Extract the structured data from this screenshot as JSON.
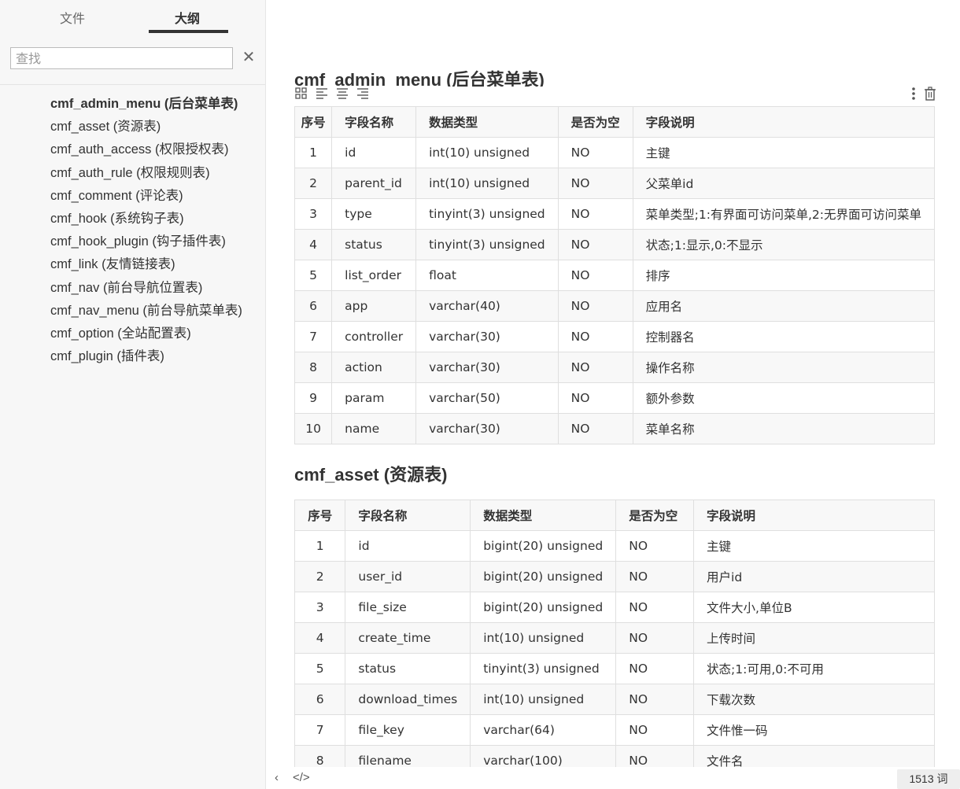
{
  "sidebar": {
    "tabs": [
      {
        "label": "文件"
      },
      {
        "label": "大纲"
      }
    ],
    "search": {
      "placeholder": "查找",
      "clear_icon": "✕"
    },
    "outline": [
      {
        "label": "cmf_admin_menu (后台菜单表)"
      },
      {
        "label": "cmf_asset (资源表)"
      },
      {
        "label": "cmf_auth_access (权限授权表)"
      },
      {
        "label": "cmf_auth_rule (权限规则表)"
      },
      {
        "label": "cmf_comment (评论表)"
      },
      {
        "label": "cmf_hook (系统钩子表)"
      },
      {
        "label": "cmf_hook_plugin (钩子插件表)"
      },
      {
        "label": "cmf_link (友情链接表)"
      },
      {
        "label": "cmf_nav (前台导航位置表)"
      },
      {
        "label": "cmf_nav_menu (前台导航菜单表)"
      },
      {
        "label": "cmf_option (全站配置表)"
      },
      {
        "label": "cmf_plugin (插件表)"
      }
    ]
  },
  "main": {
    "headers": [
      "序号",
      "字段名称",
      "数据类型",
      "是否为空",
      "字段说明"
    ],
    "table1": {
      "title": "cmf_admin_menu (后台菜单表)",
      "rows": [
        [
          "1",
          "id",
          "int(10) unsigned",
          "NO",
          "主键"
        ],
        [
          "2",
          "parent_id",
          "int(10) unsigned",
          "NO",
          "父菜单id"
        ],
        [
          "3",
          "type",
          "tinyint(3) unsigned",
          "NO",
          "菜单类型;1:有界面可访问菜单,2:无界面可访问菜单"
        ],
        [
          "4",
          "status",
          "tinyint(3) unsigned",
          "NO",
          "状态;1:显示,0:不显示"
        ],
        [
          "5",
          "list_order",
          "float",
          "NO",
          "排序"
        ],
        [
          "6",
          "app",
          "varchar(40)",
          "NO",
          "应用名"
        ],
        [
          "7",
          "controller",
          "varchar(30)",
          "NO",
          "控制器名"
        ],
        [
          "8",
          "action",
          "varchar(30)",
          "NO",
          "操作名称"
        ],
        [
          "9",
          "param",
          "varchar(50)",
          "NO",
          "额外参数"
        ],
        [
          "10",
          "name",
          "varchar(30)",
          "NO",
          "菜单名称"
        ]
      ]
    },
    "table2": {
      "title": "cmf_asset (资源表)",
      "rows": [
        [
          "1",
          "id",
          "bigint(20) unsigned",
          "NO",
          "主键"
        ],
        [
          "2",
          "user_id",
          "bigint(20) unsigned",
          "NO",
          "用户id"
        ],
        [
          "3",
          "file_size",
          "bigint(20) unsigned",
          "NO",
          "文件大小,单位B"
        ],
        [
          "4",
          "create_time",
          "int(10) unsigned",
          "NO",
          "上传时间"
        ],
        [
          "5",
          "status",
          "tinyint(3) unsigned",
          "NO",
          "状态;1:可用,0:不可用"
        ],
        [
          "6",
          "download_times",
          "int(10) unsigned",
          "NO",
          "下载次数"
        ],
        [
          "7",
          "file_key",
          "varchar(64)",
          "NO",
          "文件惟一码"
        ],
        [
          "8",
          "filename",
          "varchar(100)",
          "NO",
          "文件名"
        ]
      ]
    }
  },
  "footer": {
    "prev_icon": "‹",
    "source_icon": "</>",
    "word_count": "1513 词"
  }
}
